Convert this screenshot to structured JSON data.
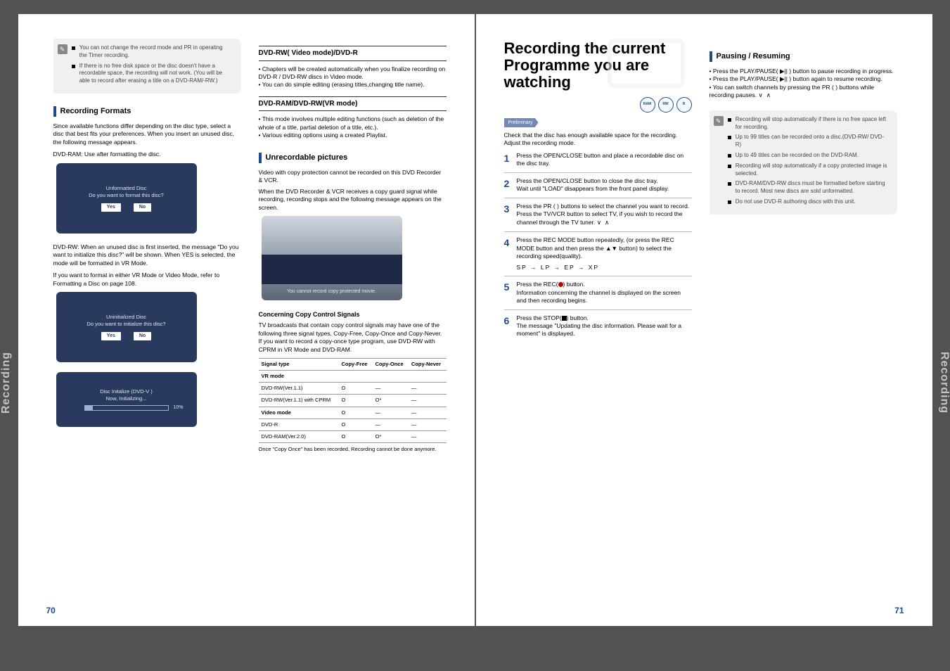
{
  "left": {
    "note1_a": "You can not change the record mode and PR in operating the Timer recording.",
    "note1_b": "If there is no free disk space or the disc doesn't have a recordable space, the recording will not work. (You will be able to record after erasing a title on a DVD-RAM/-RW.)",
    "recFormats_head": "Recording Formats",
    "recFormats_body": "Since available functions differ depending on the disc type, select a disc that best fits your preferences. When you insert an unused disc, the following message appears.",
    "ram_line": "DVD-RAM: Use after formatting the disc.",
    "screen1a": "Unformatted Disc",
    "screen1b": "Do you want to format this disc?",
    "yes": "Yes",
    "no": "No",
    "rw_intro": "DVD-RW: When an unused disc is first inserted, the message \"Do you want to initialize this disc?\" will be shown. When YES is selected, the mode will be formatted in VR Mode.",
    "rw_intro2": "If you want to format in either VR Mode or Video Mode, refer to Formatting a Disc on page 108.",
    "screen2a": "Uninitialized Disc",
    "screen2b": "Do you want to initialize this disc?",
    "screen3a": "Disc Initalize (DVD-V   )",
    "screen3b": "Now, Initializing...",
    "pct": "10%",
    "videoHead": "DVD-RW( Video mode)/DVD-R",
    "videoBullets": [
      "Chapters will be created automatically when you finalize recording on DVD-R / DVD-RW discs in Video mode.",
      "You can do simple editing (erasing titles,changing title name)."
    ],
    "vrHead": "DVD-RAM/DVD-RW(VR mode)",
    "vrBullets": [
      "This mode involves multiple editing functions (such as deletion of the whole of a title, partial deletion of a title, etc.).",
      "Various editing options using a created Playlist."
    ],
    "unrecHead": "Unrecordable pictures",
    "unrecBody1": "Video with copy protection cannot be recorded on this DVD Recorder & VCR.",
    "unrecBody2": "When the DVD Recorder & VCR receives a copy guard signal while recording, recording stops and the following message appears on the screen.",
    "unrecScreen": "You cannot record copy protected movie.",
    "ccHead": "Concerning Copy Control Signals",
    "ccBody": "TV broadcasts that contain copy control signals may have one of the following three signal types, Copy-Free, Copy-Once and Copy-Never. If you want to record a copy-once type program, use DVD-RW with CPRM in VR Mode and DVD-RAM.",
    "tbl": {
      "h": [
        "Signal type",
        "Copy-Free",
        "Copy-Once",
        "Copy-Never"
      ],
      "rows": [
        [
          "VR mode",
          "",
          "",
          " "
        ],
        [
          "DVD-RW(Ver.1.1)",
          "O",
          "—",
          "—"
        ],
        [
          "DVD-RW(Ver.1.1) with CPRM",
          "O",
          "O*",
          "—"
        ],
        [
          "Video mode",
          "O",
          "—",
          "—"
        ],
        [
          "DVD-R",
          "O",
          "—",
          "—"
        ],
        [
          "DVD-RAM(Ver.2.0)",
          "O",
          "O*",
          "—"
        ]
      ]
    },
    "cprm": "Once \"Copy Once\" has been recorded, Recording cannot be done anymore.",
    "sideTab": "Recording",
    "pno": "70"
  },
  "right": {
    "heroA": "Recording the current",
    "heroB": "Programme you are watching",
    "discs": [
      "RAM",
      "RW",
      "R"
    ],
    "prelim": "Preliminary",
    "prelimBody": "Check that the disc has enough available space for the recording. Adjust the recording mode.",
    "steps": [
      {
        "n": "1",
        "t": "Press the OPEN/CLOSE button and place a recordable disc on the disc tray."
      },
      {
        "n": "2",
        "t": "Press the OPEN/CLOSE button to close the disc tray.",
        "t2": "Wait until \"LOAD\" disappears from the front panel display."
      },
      {
        "n": "3",
        "t": "Press the PR (      ) buttons to select the channel you want to record. Press the TV/VCR button to select TV, if you wish to record the channel through the TV tuner.",
        "arrows": "∨  ∧"
      },
      {
        "n": "4",
        "t": "Press the REC MODE button repeatedly, (or press the REC MODE button and then press the ▲▼ button) to select the recording speed(quality).",
        "t2": "SP → LP → EP → XP",
        "t3": "↑                                ↓"
      },
      {
        "n": "5",
        "t": "Press the REC(   ) button.",
        "dot": true,
        "t2": "Information concerning the channel is displayed on the screen and then recording begins."
      },
      {
        "n": "6",
        "t": "Press the STOP(   ) button.",
        "sq": true,
        "t2": "The message \"Updating the disc information. Please wait for a moment\" is displayed."
      }
    ],
    "pauseHead": "Pausing / Resuming",
    "pauseBullets": [
      "Press the PLAY/PAUSE( ▶|| ) button to pause recording in progress.",
      "Press the PLAY/PAUSE( ▶|| ) button again to resume recording.",
      "You can switch channels by pressing the PR (      ) buttons while recording pauses."
    ],
    "pauseArrows": "∨  ∧",
    "note": [
      "Recording will stop automatically if there is no free space left for recording.",
      "Up to 99 titles can be recorded onto a disc.(DVD-RW/ DVD-R)",
      "Up to 49 titles can be recorded on the DVD-RAM.",
      "Recording will stop automatically if a copy protected image is selected.",
      "DVD-RAM/DVD-RW discs must be formatted before starting to record. Most new discs are sold unformatted.",
      "Do not use DVD-R authoring discs with this unit."
    ],
    "sideTab": "Recording",
    "pno": "71"
  }
}
